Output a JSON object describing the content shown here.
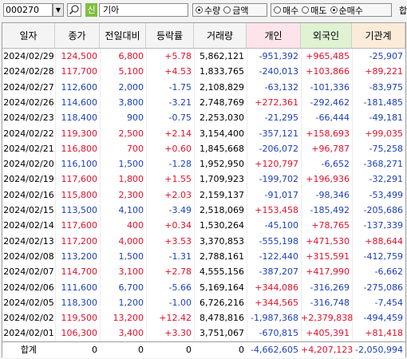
{
  "toolbar": {
    "code": "000270",
    "dropdown_icon": "▼",
    "new_label": "신",
    "stock_name": "기아",
    "unit_options": [
      {
        "label": "수량",
        "selected": true
      },
      {
        "label": "금액",
        "selected": false
      }
    ],
    "trade_options": [
      {
        "label": "매수",
        "selected": false
      },
      {
        "label": "매도",
        "selected": false
      },
      {
        "label": "순매수",
        "selected": true
      }
    ],
    "edge_char": "합"
  },
  "columns": [
    "일자",
    "종가",
    "전일대비",
    "등락률",
    "거래량",
    "개인",
    "외국인",
    "기관계"
  ],
  "rows": [
    [
      "2024/02/29",
      "124,500",
      "6,800",
      "+5.78",
      "5,862,121",
      "-951,392",
      "+965,485",
      "-25,907"
    ],
    [
      "2024/02/28",
      "117,700",
      "5,100",
      "+4.53",
      "1,833,765",
      "-240,013",
      "+103,866",
      "+89,221"
    ],
    [
      "2024/02/27",
      "112,600",
      "2,000",
      "-1.75",
      "2,108,829",
      "-63,132",
      "-101,336",
      "-83,975"
    ],
    [
      "2024/02/26",
      "114,600",
      "3,800",
      "-3.21",
      "2,748,769",
      "+272,361",
      "-292,462",
      "-181,485"
    ],
    [
      "2024/02/23",
      "118,400",
      "900",
      "-0.75",
      "2,253,030",
      "-21,295",
      "-66,444",
      "-49,181"
    ],
    [
      "2024/02/22",
      "119,300",
      "2,500",
      "+2.14",
      "3,154,400",
      "-357,121",
      "+158,693",
      "+99,035"
    ],
    [
      "2024/02/21",
      "116,800",
      "700",
      "+0.60",
      "1,845,668",
      "-206,072",
      "+96,787",
      "-75,258"
    ],
    [
      "2024/02/20",
      "116,100",
      "1,500",
      "-1.28",
      "1,952,950",
      "+120,797",
      "-6,652",
      "-368,271"
    ],
    [
      "2024/02/19",
      "117,600",
      "1,800",
      "+1.55",
      "1,709,923",
      "-199,702",
      "+196,936",
      "-32,291"
    ],
    [
      "2024/02/16",
      "115,800",
      "2,300",
      "+2.03",
      "2,159,137",
      "-91,017",
      "-98,346",
      "-53,499"
    ],
    [
      "2024/02/15",
      "113,500",
      "4,100",
      "-3.49",
      "2,518,069",
      "+153,458",
      "-185,492",
      "-205,686"
    ],
    [
      "2024/02/14",
      "117,600",
      "400",
      "+0.34",
      "1,530,264",
      "-45,100",
      "+78,765",
      "-137,339"
    ],
    [
      "2024/02/13",
      "117,200",
      "4,000",
      "+3.53",
      "3,370,853",
      "-555,198",
      "+471,530",
      "+88,644"
    ],
    [
      "2024/02/08",
      "113,200",
      "1,500",
      "-1.31",
      "2,788,161",
      "-122,440",
      "+315,591",
      "-412,759"
    ],
    [
      "2024/02/07",
      "114,700",
      "3,100",
      "+2.78",
      "4,555,156",
      "-387,207",
      "+417,990",
      "-6,662"
    ],
    [
      "2024/02/06",
      "111,600",
      "6,700",
      "-5.66",
      "5,169,164",
      "+344,086",
      "-316,269",
      "-275,086"
    ],
    [
      "2024/02/05",
      "118,300",
      "1,200",
      "-1.00",
      "6,726,216",
      "+344,565",
      "-316,748",
      "-7,454"
    ],
    [
      "2024/02/02",
      "119,500",
      "13,200",
      "+12.42",
      "8,478,816",
      "-1,987,368",
      "+2,379,838",
      "-494,459"
    ],
    [
      "2024/02/01",
      "106,300",
      "3,400",
      "+3.30",
      "3,751,067",
      "-670,815",
      "+405,391",
      "+81,418"
    ]
  ],
  "summary": [
    "합계",
    "0",
    "0",
    "0",
    "0",
    "-4,662,605",
    "+4,207,123",
    "-2,050,994"
  ],
  "colors": {
    "up": "#e0102a",
    "down": "#1c3fb8",
    "individual_header": "#fde4ea",
    "foreign_header": "#dff2d2",
    "institution_header": "#fdebd9"
  }
}
